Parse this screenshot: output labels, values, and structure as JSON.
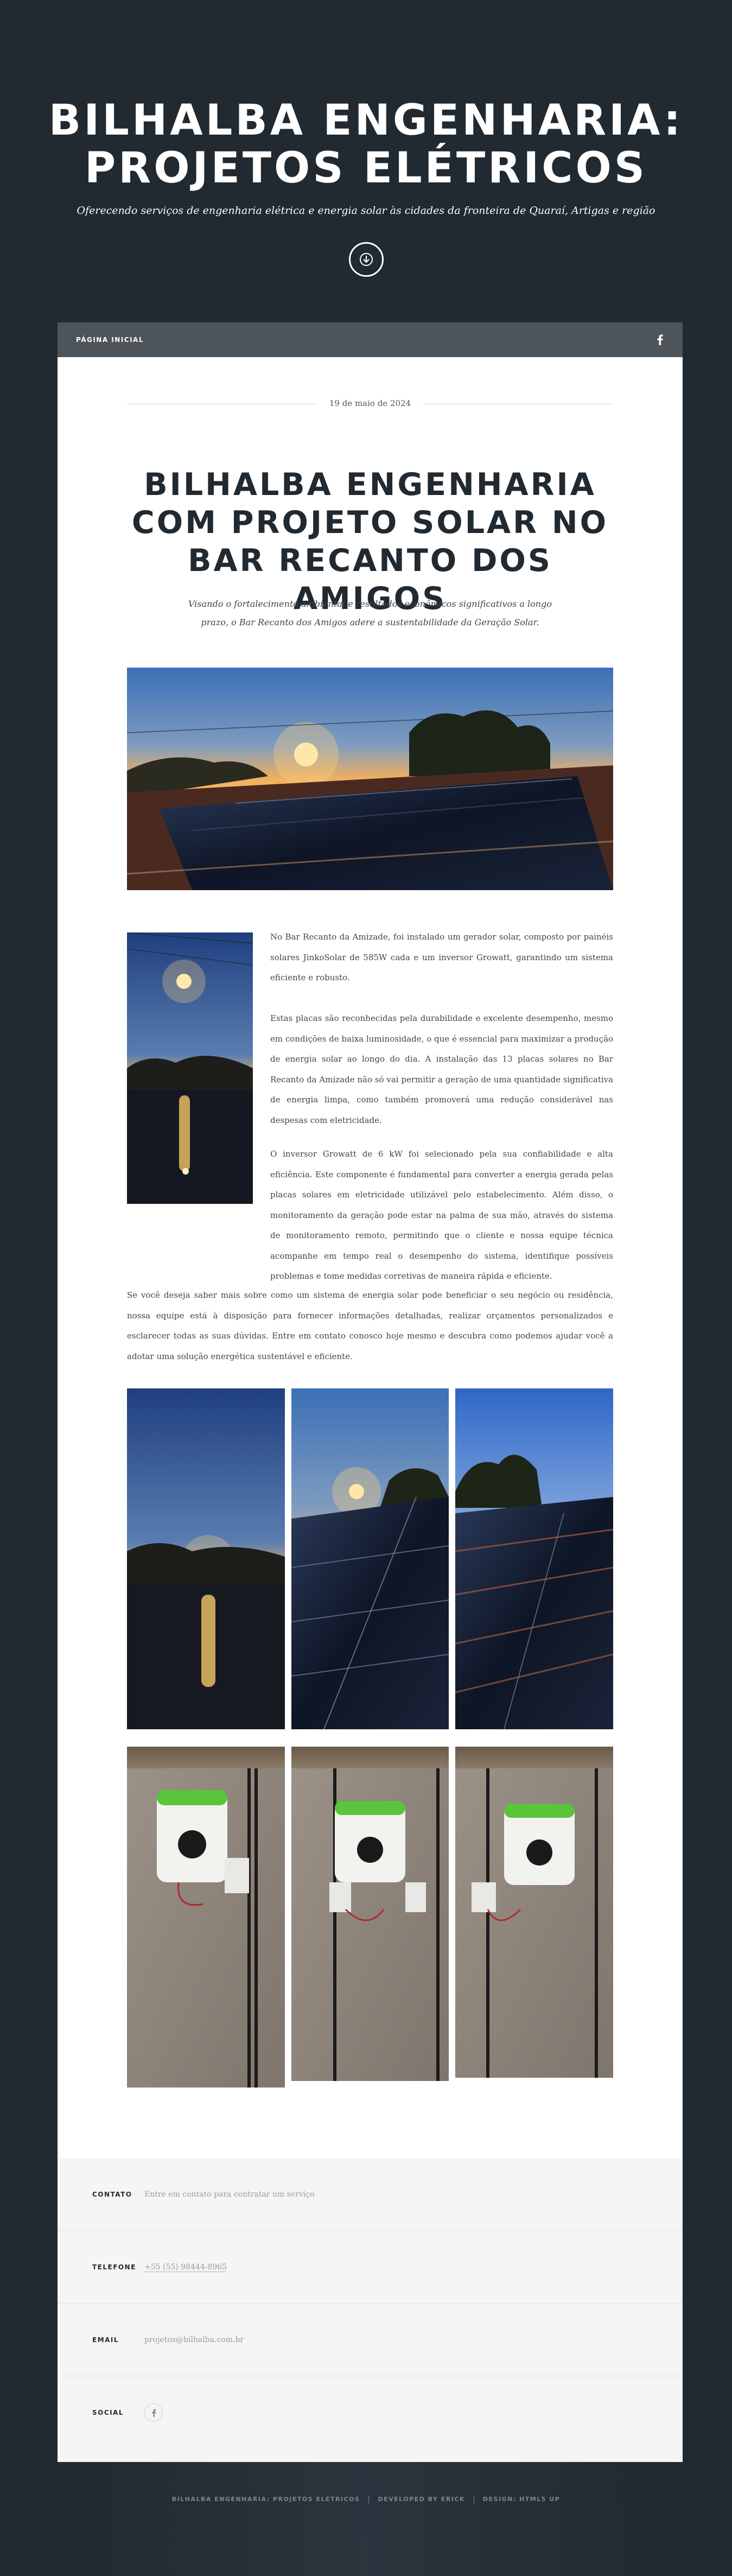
{
  "header": {
    "title": "BILHALBA ENGENHARIA: PROJETOS ELÉTRICOS",
    "tagline": "Oferecendo serviços de engenharia elétrica e energia solar às cidades da fronteira de Quaraí, Artigas e região",
    "scroll_icon": "arrow-down-circle-icon"
  },
  "nav": {
    "home_label": "PÁGINA INICIAL",
    "facebook_icon": "facebook-icon"
  },
  "post": {
    "date": "19 de maio de 2024",
    "title": "BILHALBA ENGENHARIA COM PROJETO SOLAR NO BAR RECANTO DOS AMIGOS",
    "lead": "Visando o fortalecimento ambiental e resultados econômicos significativos a longo prazo, o Bar Recanto dos Amigos adere a sustentabilidade da Geração Solar.",
    "paragraphs": [
      "No Bar Recanto da Amizade, foi instalado um gerador solar, composto por painéis solares JinkoSolar de 585W cada e um inversor Growatt, garantindo um sistema eficiente e robusto.",
      "Estas placas são reconhecidas pela durabilidade e excelente desempenho, mesmo em condições de baixa luminosidade, o que é essencial para maximizar a produção de energia solar ao longo do dia. A instalação das 13 placas solares no Bar Recanto da Amizade não só vai permitir a geração de uma quantidade significativa de energia limpa, como também promoverá uma redução considerável nas despesas com eletricidade.",
      "O inversor Growatt de 6 kW foi selecionado pela sua confiabilidade e alta eficiência. Este componente é fundamental para converter a energia gerada pelas placas solares em eletricidade utilizável pelo estabelecimento. Além disso, o monitoramento da geração pode estar na palma de sua mão, através do sistema de monitoramento remoto, permitindo que o cliente e nossa equipe técnica acompanhe em tempo real o desempenho do sistema, identifique possíveis problemas e tome medidas corretivas de maneira rápida e eficiente.",
      "Se você deseja saber mais sobre como um sistema de energia solar pode beneficiar o seu negócio ou residência, nossa equipe está à disposição para fornecer informações detalhadas, realizar orçamentos personalizados e esclarecer todas as suas dúvidas. Entre em contato conosco hoje mesmo e descubra como podemos ajudar você a adotar uma solução energética sustentável e eficiente."
    ]
  },
  "footer": {
    "contact_label": "CONTATO",
    "contact_value": "Entre em contato para contratar um serviço",
    "phone_label": "TELEFONE",
    "phone_value": "+55 (55) 98444-8965",
    "email_label": "EMAIL",
    "email_value": "projetos@bilhalba.com.br",
    "social_label": "SOCIAL",
    "social_icon": "facebook-icon"
  },
  "copyright": {
    "site": "BILHALBA ENGENHARIA: PROJETOS ELÉTRICOS",
    "developer": "DEVELOPED BY ERICK",
    "design": "DESIGN: HTML5 UP"
  },
  "colors": {
    "background": "#212931",
    "nav": "#4d545a",
    "content": "#ffffff",
    "footer": "#f5f5f5",
    "inverter_green": "#5ac43c"
  }
}
